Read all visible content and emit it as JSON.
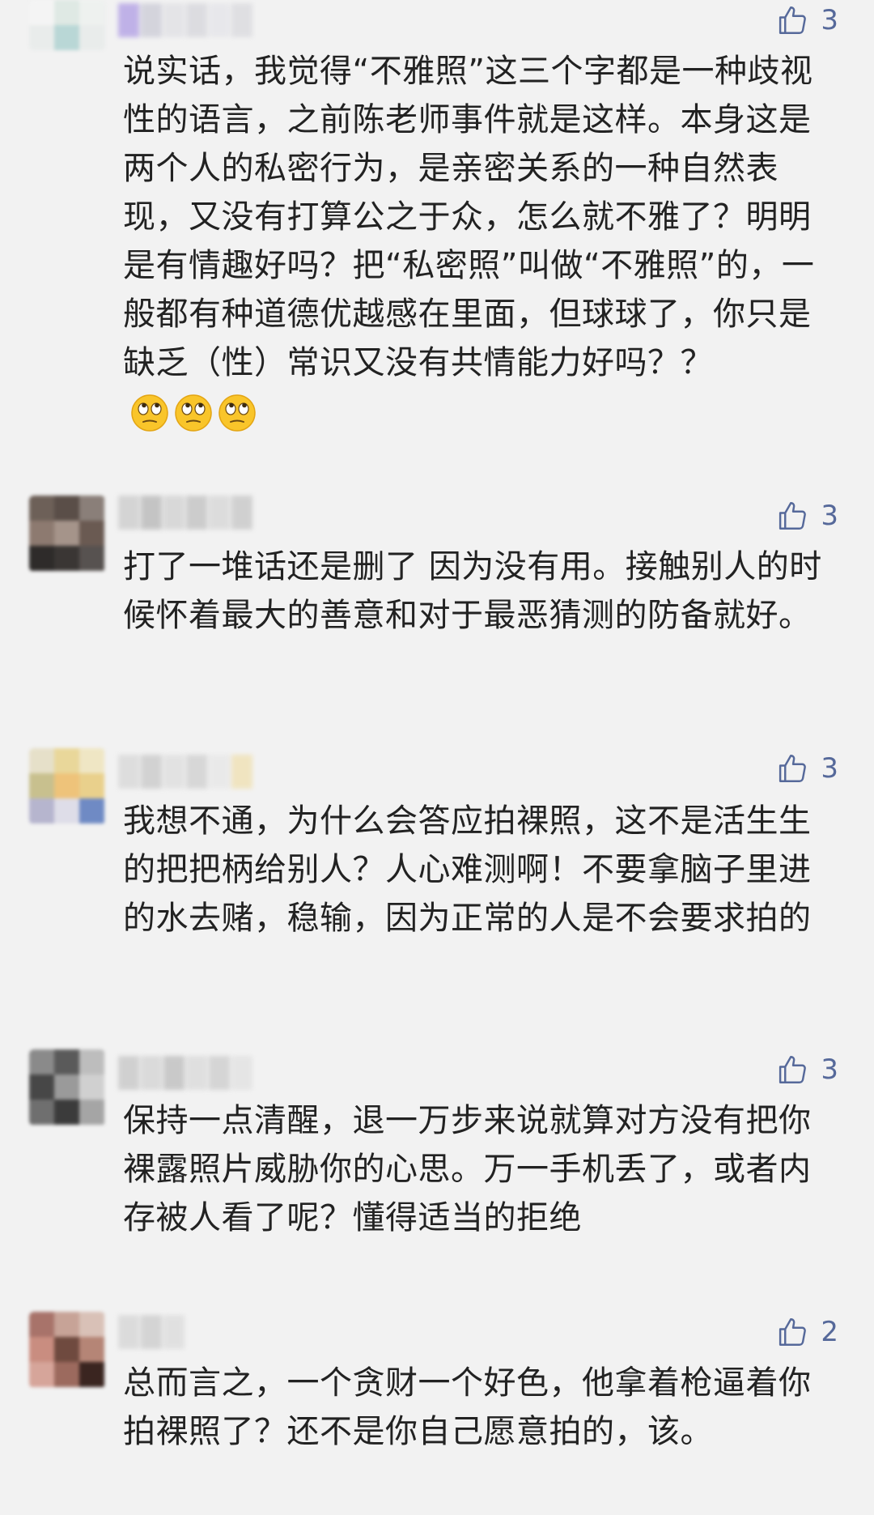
{
  "comments": [
    {
      "likes": "3",
      "text": "说实话，我觉得“不雅照”这三个字都是一种歧视性的语言，之前陈老师事件就是这样。本身这是两个人的私密行为，是亲密关系的一种自然表现，又没有打算公之于众，怎么就不雅了？明明是有情趣好吗？把“私密照”叫做“不雅照”的，一般都有种道德优越感在里面，但球球了，你只是缺乏（性）常识又没有共情能力好吗？？",
      "emojis": [
        "rolling-eyes",
        "rolling-eyes",
        "rolling-eyes"
      ]
    },
    {
      "likes": "3",
      "text": "打了一堆话还是删了 因为没有用。接触别人的时候怀着最大的善意和对于最恶猜测的防备就好。"
    },
    {
      "likes": "3",
      "text": "我想不通，为什么会答应拍裸照，这不是活生生的把把柄给别人？人心难测啊！不要拿脑子里进的水去赌，稳输，因为正常的人是不会要求拍的"
    },
    {
      "likes": "3",
      "text": "保持一点清醒，退一万步来说就算对方没有把你裸露照片威胁你的心思。万一手机丢了，或者内存被人看了呢？懂得适当的拒绝"
    },
    {
      "likes": "2",
      "text": "总而言之，一个贪财一个好色，他拿着枪逼着你拍裸照了？还不是你自己愿意拍的，该。"
    }
  ],
  "colors": {
    "background": "#f2f2f2",
    "text": "#222222",
    "like_accent": "#56699a"
  },
  "icons": {
    "like": "thumbs-up-icon",
    "emoji": "rolling-eyes-emoji-icon"
  }
}
